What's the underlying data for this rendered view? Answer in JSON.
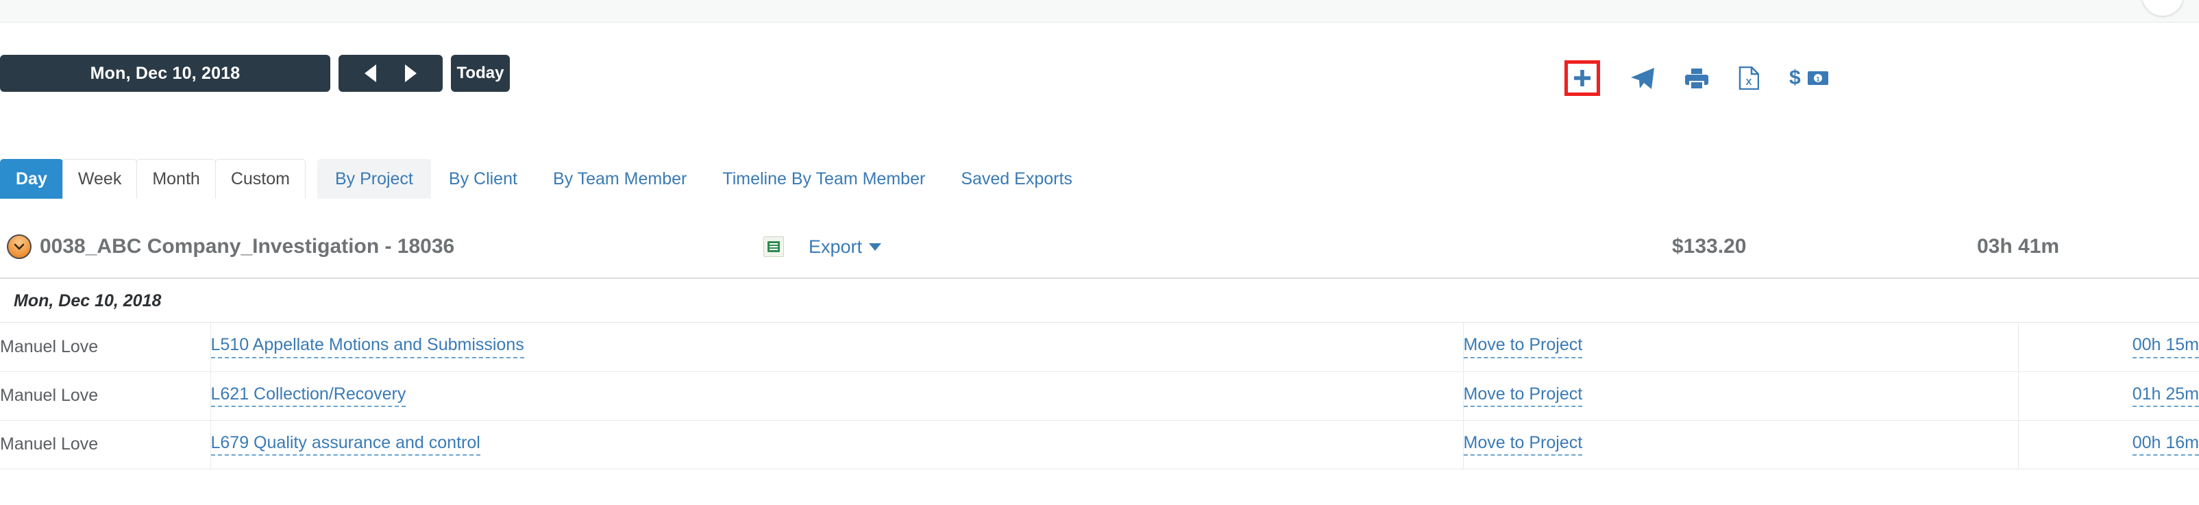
{
  "topbar": {
    "avatar_label": "user-avatar"
  },
  "date_nav": {
    "current_date": "Mon, Dec 10, 2018",
    "prev_label": "◀",
    "next_label": "▶",
    "today_label": "Today"
  },
  "actions": {
    "add_label": "+",
    "add_name": "add-time-entry",
    "send_name": "send-icon",
    "print_name": "print-icon",
    "excel_name": "excel-export-icon",
    "money_dollar": "$",
    "money_name": "money-icon",
    "highlight_color": "#ef2020",
    "icon_color": "#3a7ab5"
  },
  "tabs": {
    "period": [
      {
        "label": "Day",
        "active": true
      },
      {
        "label": "Week",
        "active": false
      },
      {
        "label": "Month",
        "active": false
      },
      {
        "label": "Custom",
        "active": false
      }
    ],
    "grouping": [
      {
        "label": "By Project",
        "active": true
      },
      {
        "label": "By Client",
        "active": false
      },
      {
        "label": "By Team Member",
        "active": false
      },
      {
        "label": "Timeline By Team Member",
        "active": false
      },
      {
        "label": "Saved Exports",
        "active": false
      }
    ],
    "active_color": "#2b8cce"
  },
  "project": {
    "title": "0038_ABC Company_Investigation - 18036",
    "collapse_icon": "clock-icon",
    "export_label": "Export",
    "amount": "$133.20",
    "duration": "03h 41m"
  },
  "date_group": {
    "label": "Mon, Dec 10, 2018"
  },
  "table": {
    "move_label": "Move to Project",
    "rows": [
      {
        "member": "Manuel Love",
        "task": "L510 Appellate Motions and Submissions",
        "move": "Move to Project",
        "duration": "00h 15m"
      },
      {
        "member": "Manuel Love",
        "task": "L621 Collection/Recovery",
        "move": "Move to Project",
        "duration": "01h 25m"
      },
      {
        "member": "Manuel Love",
        "task": "L679 Quality assurance and control",
        "move": "Move to Project",
        "duration": "00h 16m"
      }
    ]
  }
}
